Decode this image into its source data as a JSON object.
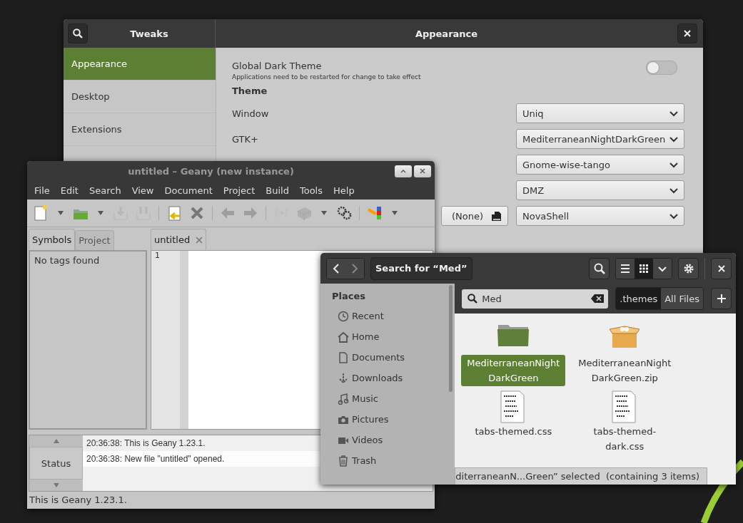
{
  "tweaks": {
    "app_title": "Tweaks",
    "page_title": "Appearance",
    "sidebar": [
      {
        "label": "Appearance",
        "selected": true
      },
      {
        "label": "Desktop",
        "selected": false
      },
      {
        "label": "Extensions",
        "selected": false
      }
    ],
    "dark_theme": {
      "label": "Global Dark Theme",
      "note": "Applications need to be restarted for change to take effect",
      "on": false
    },
    "section": "Theme",
    "rows": [
      {
        "label": "Window",
        "value": "Uniq"
      },
      {
        "label": "GTK+",
        "value": "MediterraneanNightDarkGreen"
      },
      {
        "value": "Gnome-wise-tango"
      },
      {
        "value": "DMZ"
      },
      {
        "value": "NovaShell",
        "file_button": "(None)"
      }
    ]
  },
  "geany": {
    "title": "untitled – Geany (new instance)",
    "menu": [
      "File",
      "Edit",
      "Search",
      "View",
      "Document",
      "Project",
      "Build",
      "Tools",
      "Help"
    ],
    "toolbar": [
      {
        "kind": "new",
        "disabled": false
      },
      {
        "kind": "caret",
        "disabled": false
      },
      {
        "kind": "open",
        "disabled": false
      },
      {
        "kind": "caret",
        "disabled": false
      },
      {
        "kind": "save",
        "disabled": true
      },
      {
        "kind": "saveall",
        "disabled": true
      },
      {
        "kind": "sep"
      },
      {
        "kind": "revert",
        "disabled": false
      },
      {
        "kind": "close",
        "disabled": false
      },
      {
        "kind": "sep"
      },
      {
        "kind": "back",
        "disabled": true
      },
      {
        "kind": "forward",
        "disabled": true
      },
      {
        "kind": "sep"
      },
      {
        "kind": "compile",
        "disabled": true
      },
      {
        "kind": "build",
        "disabled": true
      },
      {
        "kind": "caret",
        "disabled": false
      },
      {
        "kind": "run",
        "disabled": false
      },
      {
        "kind": "sep"
      },
      {
        "kind": "color",
        "disabled": false
      },
      {
        "kind": "caret",
        "disabled": false
      }
    ],
    "side_tabs": [
      {
        "label": "Symbols",
        "selected": true
      },
      {
        "label": "Project",
        "selected": false
      }
    ],
    "side_text": "No tags found",
    "doc_tab": "untitled",
    "line_number": "1",
    "message_tab": "Status",
    "log": [
      "20:36:38: This is Geany 1.23.1.",
      "20:36:38: New file \"untitled\" opened."
    ],
    "statusbar": "This is Geany 1.23.1."
  },
  "files": {
    "title": "Search for “Med”",
    "view": [
      {
        "kind": "list",
        "selected": false
      },
      {
        "kind": "grid",
        "selected": true
      }
    ],
    "places_heading": "Places",
    "places": [
      {
        "kind": "recent",
        "label": "Recent"
      },
      {
        "kind": "home",
        "label": "Home"
      },
      {
        "kind": "documents",
        "label": "Documents"
      },
      {
        "kind": "downloads",
        "label": "Downloads"
      },
      {
        "kind": "music",
        "label": "Music"
      },
      {
        "kind": "pictures",
        "label": "Pictures"
      },
      {
        "kind": "videos",
        "label": "Videos"
      },
      {
        "kind": "trash",
        "label": "Trash"
      }
    ],
    "search": {
      "value": "Med"
    },
    "filters": [
      {
        "label": ".themes",
        "selected": true
      },
      {
        "label": "All Files",
        "selected": false
      }
    ],
    "items": [
      {
        "kind": "folder",
        "name": "MediterraneanNightDarkGreen",
        "selected": true
      },
      {
        "kind": "archive",
        "name": "MediterraneanNightDarkGreen.zip",
        "selected": false
      },
      {
        "kind": "text",
        "name": "tabs-themed.css",
        "selected": false
      },
      {
        "kind": "text",
        "name": "tabs-themed-dark.css",
        "selected": false
      }
    ],
    "status": "diterraneanN...Green” selected  (containing 3 items)"
  }
}
